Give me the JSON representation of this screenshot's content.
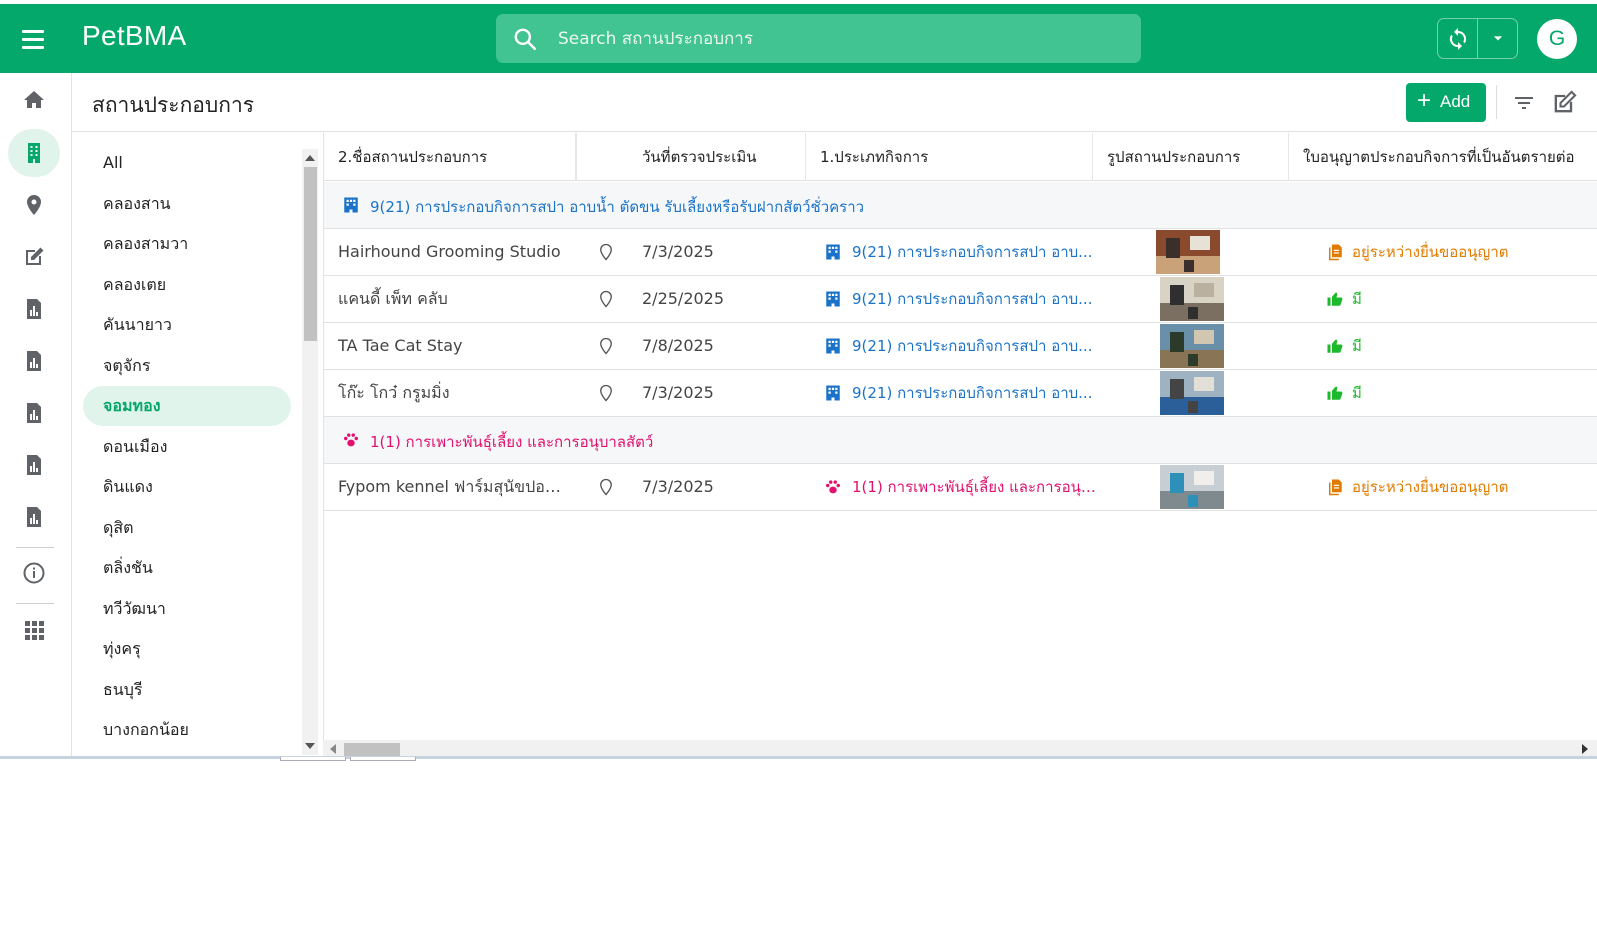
{
  "app": {
    "title": "PetBMA",
    "search_placeholder": "Search สถานประกอบการ",
    "user_initial": "G",
    "accent": "#04a86a"
  },
  "header": {
    "title": "สถานประกอบการ",
    "add_label": "Add"
  },
  "rail": {
    "items": [
      "home-icon",
      "building-icon",
      "location-pin-icon",
      "edit-note-icon",
      "report-icon",
      "report-icon",
      "report-icon",
      "report-icon",
      "report-icon",
      "info-icon",
      "apps-grid-icon"
    ],
    "active_index": 1
  },
  "groups": {
    "items": [
      "All",
      "คลองสาน",
      "คลองสามวา",
      "คลองเตย",
      "คันนายาว",
      "จตุจักร",
      "จอมทอง",
      "ดอนเมือง",
      "ดินแดง",
      "ดุสิต",
      "ตลิ่งชัน",
      "ทวีวัฒนา",
      "ทุ่งครุ",
      "ธนบุรี",
      "บางกอกน้อย"
    ],
    "selected_index": 6
  },
  "table": {
    "columns": [
      "2.ชื่อสถานประกอบการ",
      "",
      "วันที่ตรวจประเมิน",
      "1.ประเภทกิจการ",
      "รูปสถานประกอบการ",
      "ใบอนุญาตประกอบกิจการที่เป็นอันตรายต่อ"
    ],
    "groups": [
      {
        "label": "9(21) การประกอบกิจการสปา อาบน้ำ ตัดขน รับเลี้ยงหรือรับฝากสัตว์ชั่วคราว",
        "icon": "building-icon",
        "color": "#1a73c8",
        "rows": [
          {
            "name": "Hairhound Grooming Studio",
            "date": "7/3/2025",
            "type": "9(21) การประกอบกิจการสปา อาบ...",
            "license": "อยู่ระหว่างยื่นขออนุญาต",
            "license_status": "pending"
          },
          {
            "name": "แคนดี้ เพ็ท คลับ",
            "date": "2/25/2025",
            "type": "9(21) การประกอบกิจการสปา อาบ...",
            "license": "มี",
            "license_status": "yes"
          },
          {
            "name": "TA Tae Cat Stay",
            "date": "7/8/2025",
            "type": "9(21) การประกอบกิจการสปา อาบ...",
            "license": "มี",
            "license_status": "yes"
          },
          {
            "name": "โก๊ะ โกว๋ กรูมมิ่ง",
            "date": "7/3/2025",
            "type": "9(21) การประกอบกิจการสปา อาบ...",
            "license": "มี",
            "license_status": "yes"
          }
        ]
      },
      {
        "label": "1(1) การเพาะพันธุ์เลี้ยง และการอนุบาลสัตว์",
        "icon": "paw-icon",
        "color": "#e0116f",
        "rows": [
          {
            "name": "Fypom kennel ฟาร์มสุนัขปอมเม...",
            "date": "7/3/2025",
            "type": "1(1) การเพาะพันธุ์เลี้ยง และการอนุบ...",
            "license": "อยู่ระหว่างยื่นขออนุญาต",
            "license_status": "pending"
          }
        ]
      }
    ]
  },
  "colors": {
    "pending": "#e07b00",
    "yes": "#1db92c",
    "type_spa": "#1a73c8",
    "type_breed": "#e0116f"
  }
}
